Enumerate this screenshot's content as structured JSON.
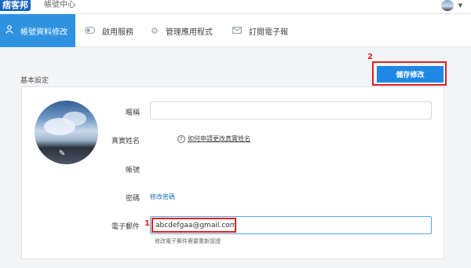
{
  "app": {
    "logo": "痞客邦",
    "title": "帳號中心"
  },
  "nav": {
    "items": [
      {
        "label": "帳號資料修改",
        "icon": "user-icon",
        "active": true
      },
      {
        "label": "啟用服務",
        "icon": "toggle-icon",
        "active": false
      },
      {
        "label": "管理應用程式",
        "icon": "gear-icon",
        "active": false
      },
      {
        "label": "訂閱電子報",
        "icon": "mail-icon",
        "active": false
      }
    ]
  },
  "section": {
    "title": "基本設定",
    "save_label": "儲存修改",
    "save_marker": "2"
  },
  "form": {
    "nickname_label": "暱稱",
    "nickname_value": "",
    "realname_label": "真實姓名",
    "realname_help": "如何申請更改真實姓名",
    "account_label": "帳號",
    "account_value": "",
    "password_label": "密碼",
    "password_link": "修改密碼",
    "email_label": "電子郵件",
    "email_marker": "1",
    "email_value": "abcdefgaa@gmail.com",
    "email_note": "修改電子郵件需要重新認證"
  },
  "colors": {
    "accent": "#2f92e0",
    "button": "#1e88e5",
    "annotation": "#e02020"
  }
}
